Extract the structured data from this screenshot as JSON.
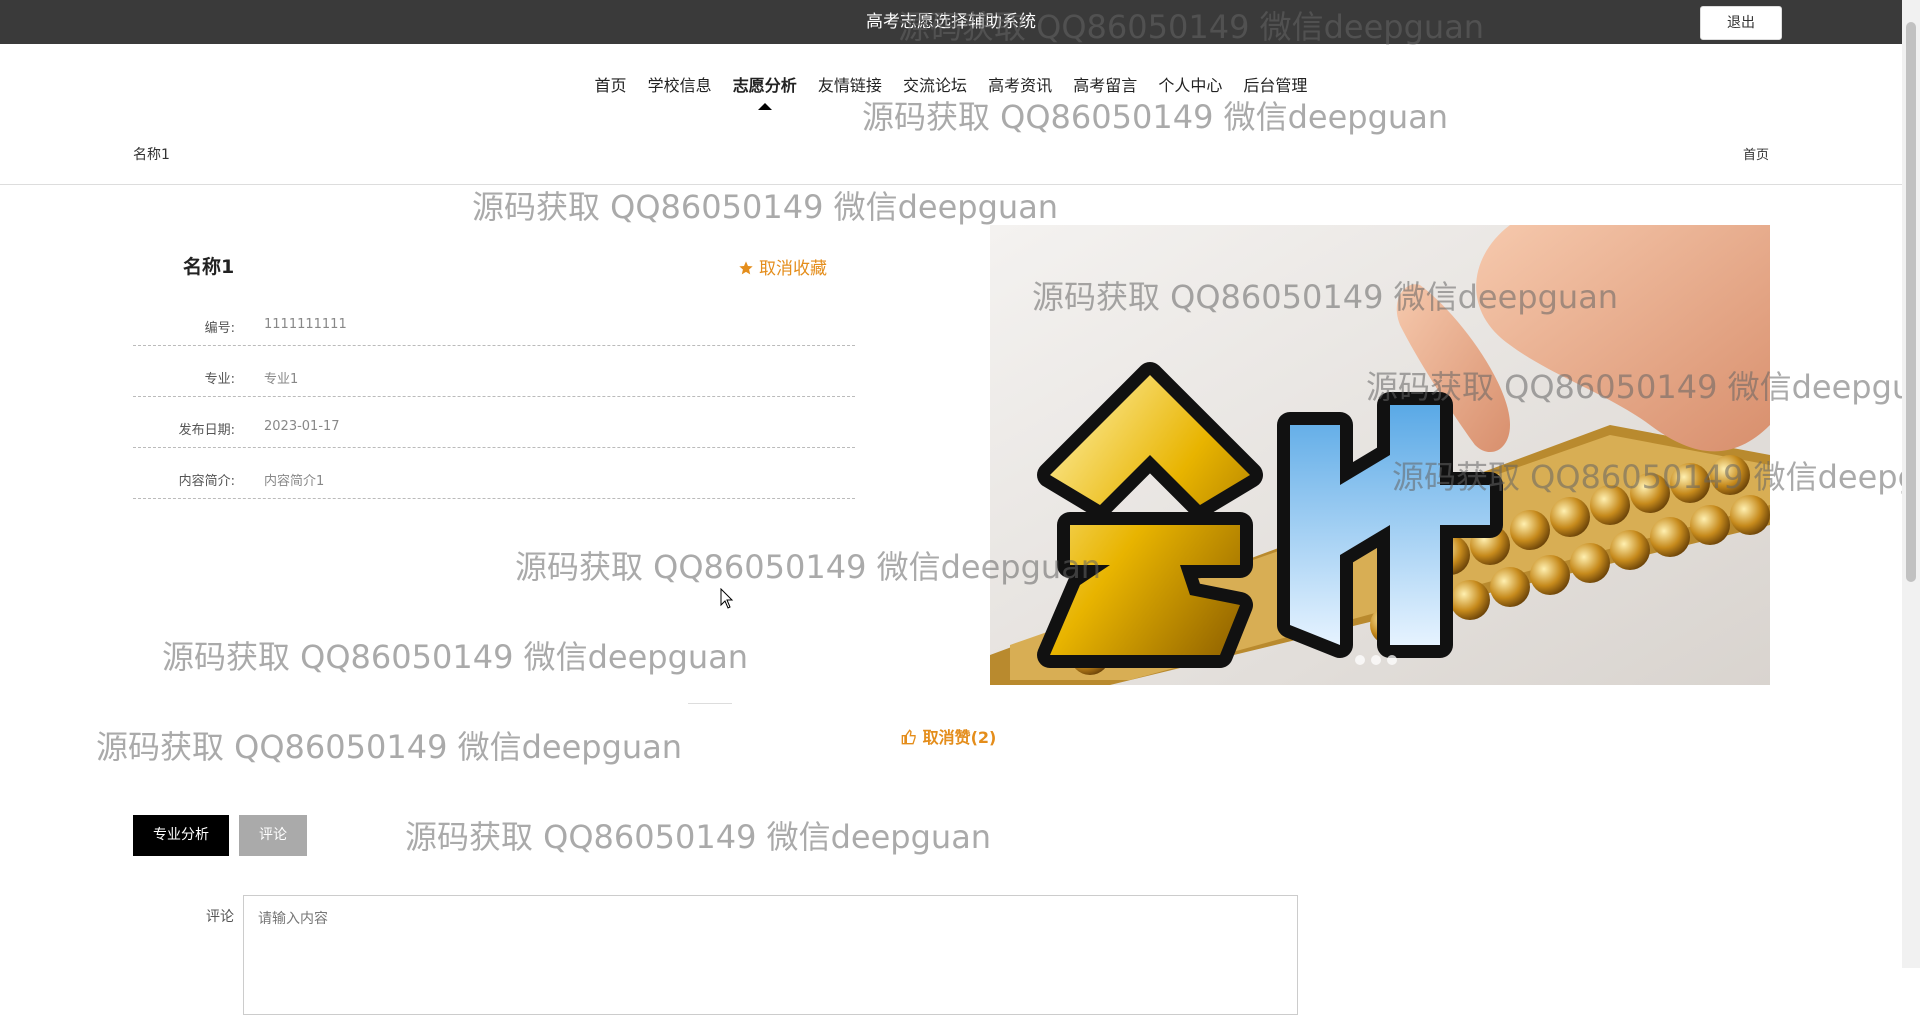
{
  "header": {
    "title": "高考志愿选择辅助系统",
    "logout_label": "退出"
  },
  "nav": {
    "items": [
      "首页",
      "学校信息",
      "志愿分析",
      "友情链接",
      "交流论坛",
      "高考资讯",
      "高考留言",
      "个人中心",
      "后台管理"
    ],
    "active": "志愿分析"
  },
  "breadcrumb": {
    "current": "名称1",
    "home": "首页"
  },
  "detail": {
    "name": "名称1",
    "favorite_label": "取消收藏",
    "fields": [
      {
        "label": "编号:",
        "value": "1111111111"
      },
      {
        "label": "专业:",
        "value": "专业1"
      },
      {
        "label": "发布日期:",
        "value": "2023-01-17"
      },
      {
        "label": "内容简介:",
        "value": "内容简介1"
      }
    ]
  },
  "banner": {
    "text": "会计",
    "dot_count": 3
  },
  "like": {
    "label": "取消赞(2)"
  },
  "tabs": {
    "analysis": "专业分析",
    "comment": "评论"
  },
  "comment": {
    "label": "评论",
    "placeholder": "请输入内容"
  },
  "watermark": "源码获取 QQ86050149 微信deepguan",
  "colors": {
    "accent": "#e48d1b",
    "topbar": "#3a3a3a",
    "tab_active": "#000000",
    "tab_inactive": "#aaaaaa"
  }
}
